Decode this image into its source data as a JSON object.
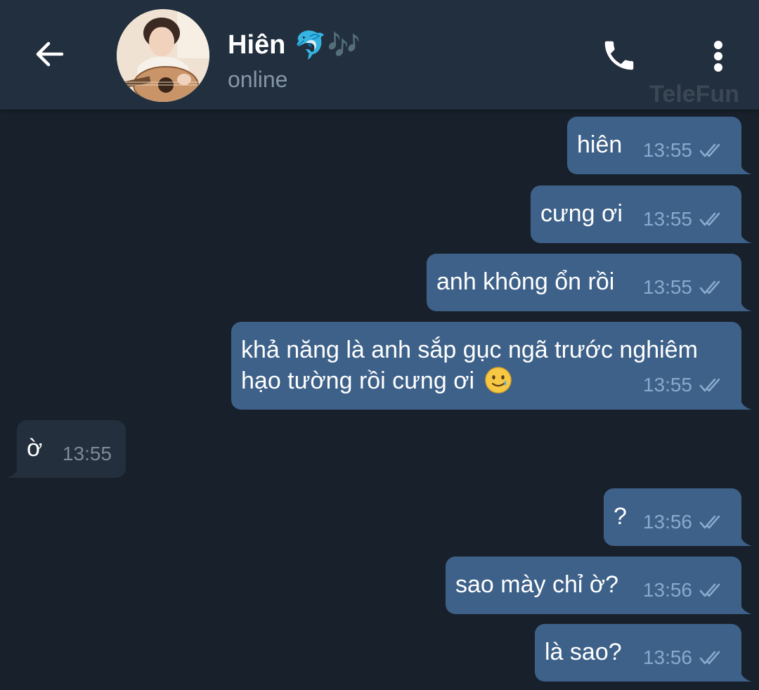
{
  "header": {
    "contact_name": "Hiên",
    "name_emoji": "🐬🎶",
    "status": "online",
    "watermark": "TeleFun",
    "back_icon": "arrow-left-icon",
    "call_icon": "phone-icon",
    "menu_icon": "more-vertical-icon"
  },
  "colors": {
    "header_bg": "#222f3e",
    "chat_bg": "#18202b",
    "outgoing_bubble": "#3e6189",
    "incoming_bubble": "#232f3c",
    "outgoing_meta": "#89a9cc",
    "incoming_meta": "#7c8a99"
  },
  "messages": [
    {
      "direction": "out",
      "text": "hiên",
      "time": "13:55",
      "status": "read"
    },
    {
      "direction": "out",
      "text": "cưng ơi",
      "time": "13:55",
      "status": "read"
    },
    {
      "direction": "out",
      "text": "anh không ổn rồi",
      "time": "13:55",
      "status": "read"
    },
    {
      "direction": "out",
      "text": "khả năng là anh sắp gục ngã trước nghiêm hạo tường rồi cưng ơi",
      "emoji": "smiling-face-with-tear",
      "time": "13:55",
      "status": "read"
    },
    {
      "direction": "in",
      "text": "ờ",
      "time": "13:55"
    },
    {
      "direction": "out",
      "text": "?",
      "time": "13:56",
      "status": "read"
    },
    {
      "direction": "out",
      "text": "sao mày chỉ ờ?",
      "time": "13:56",
      "status": "read"
    },
    {
      "direction": "out",
      "text": "là sao?",
      "time": "13:56",
      "status": "read"
    }
  ]
}
